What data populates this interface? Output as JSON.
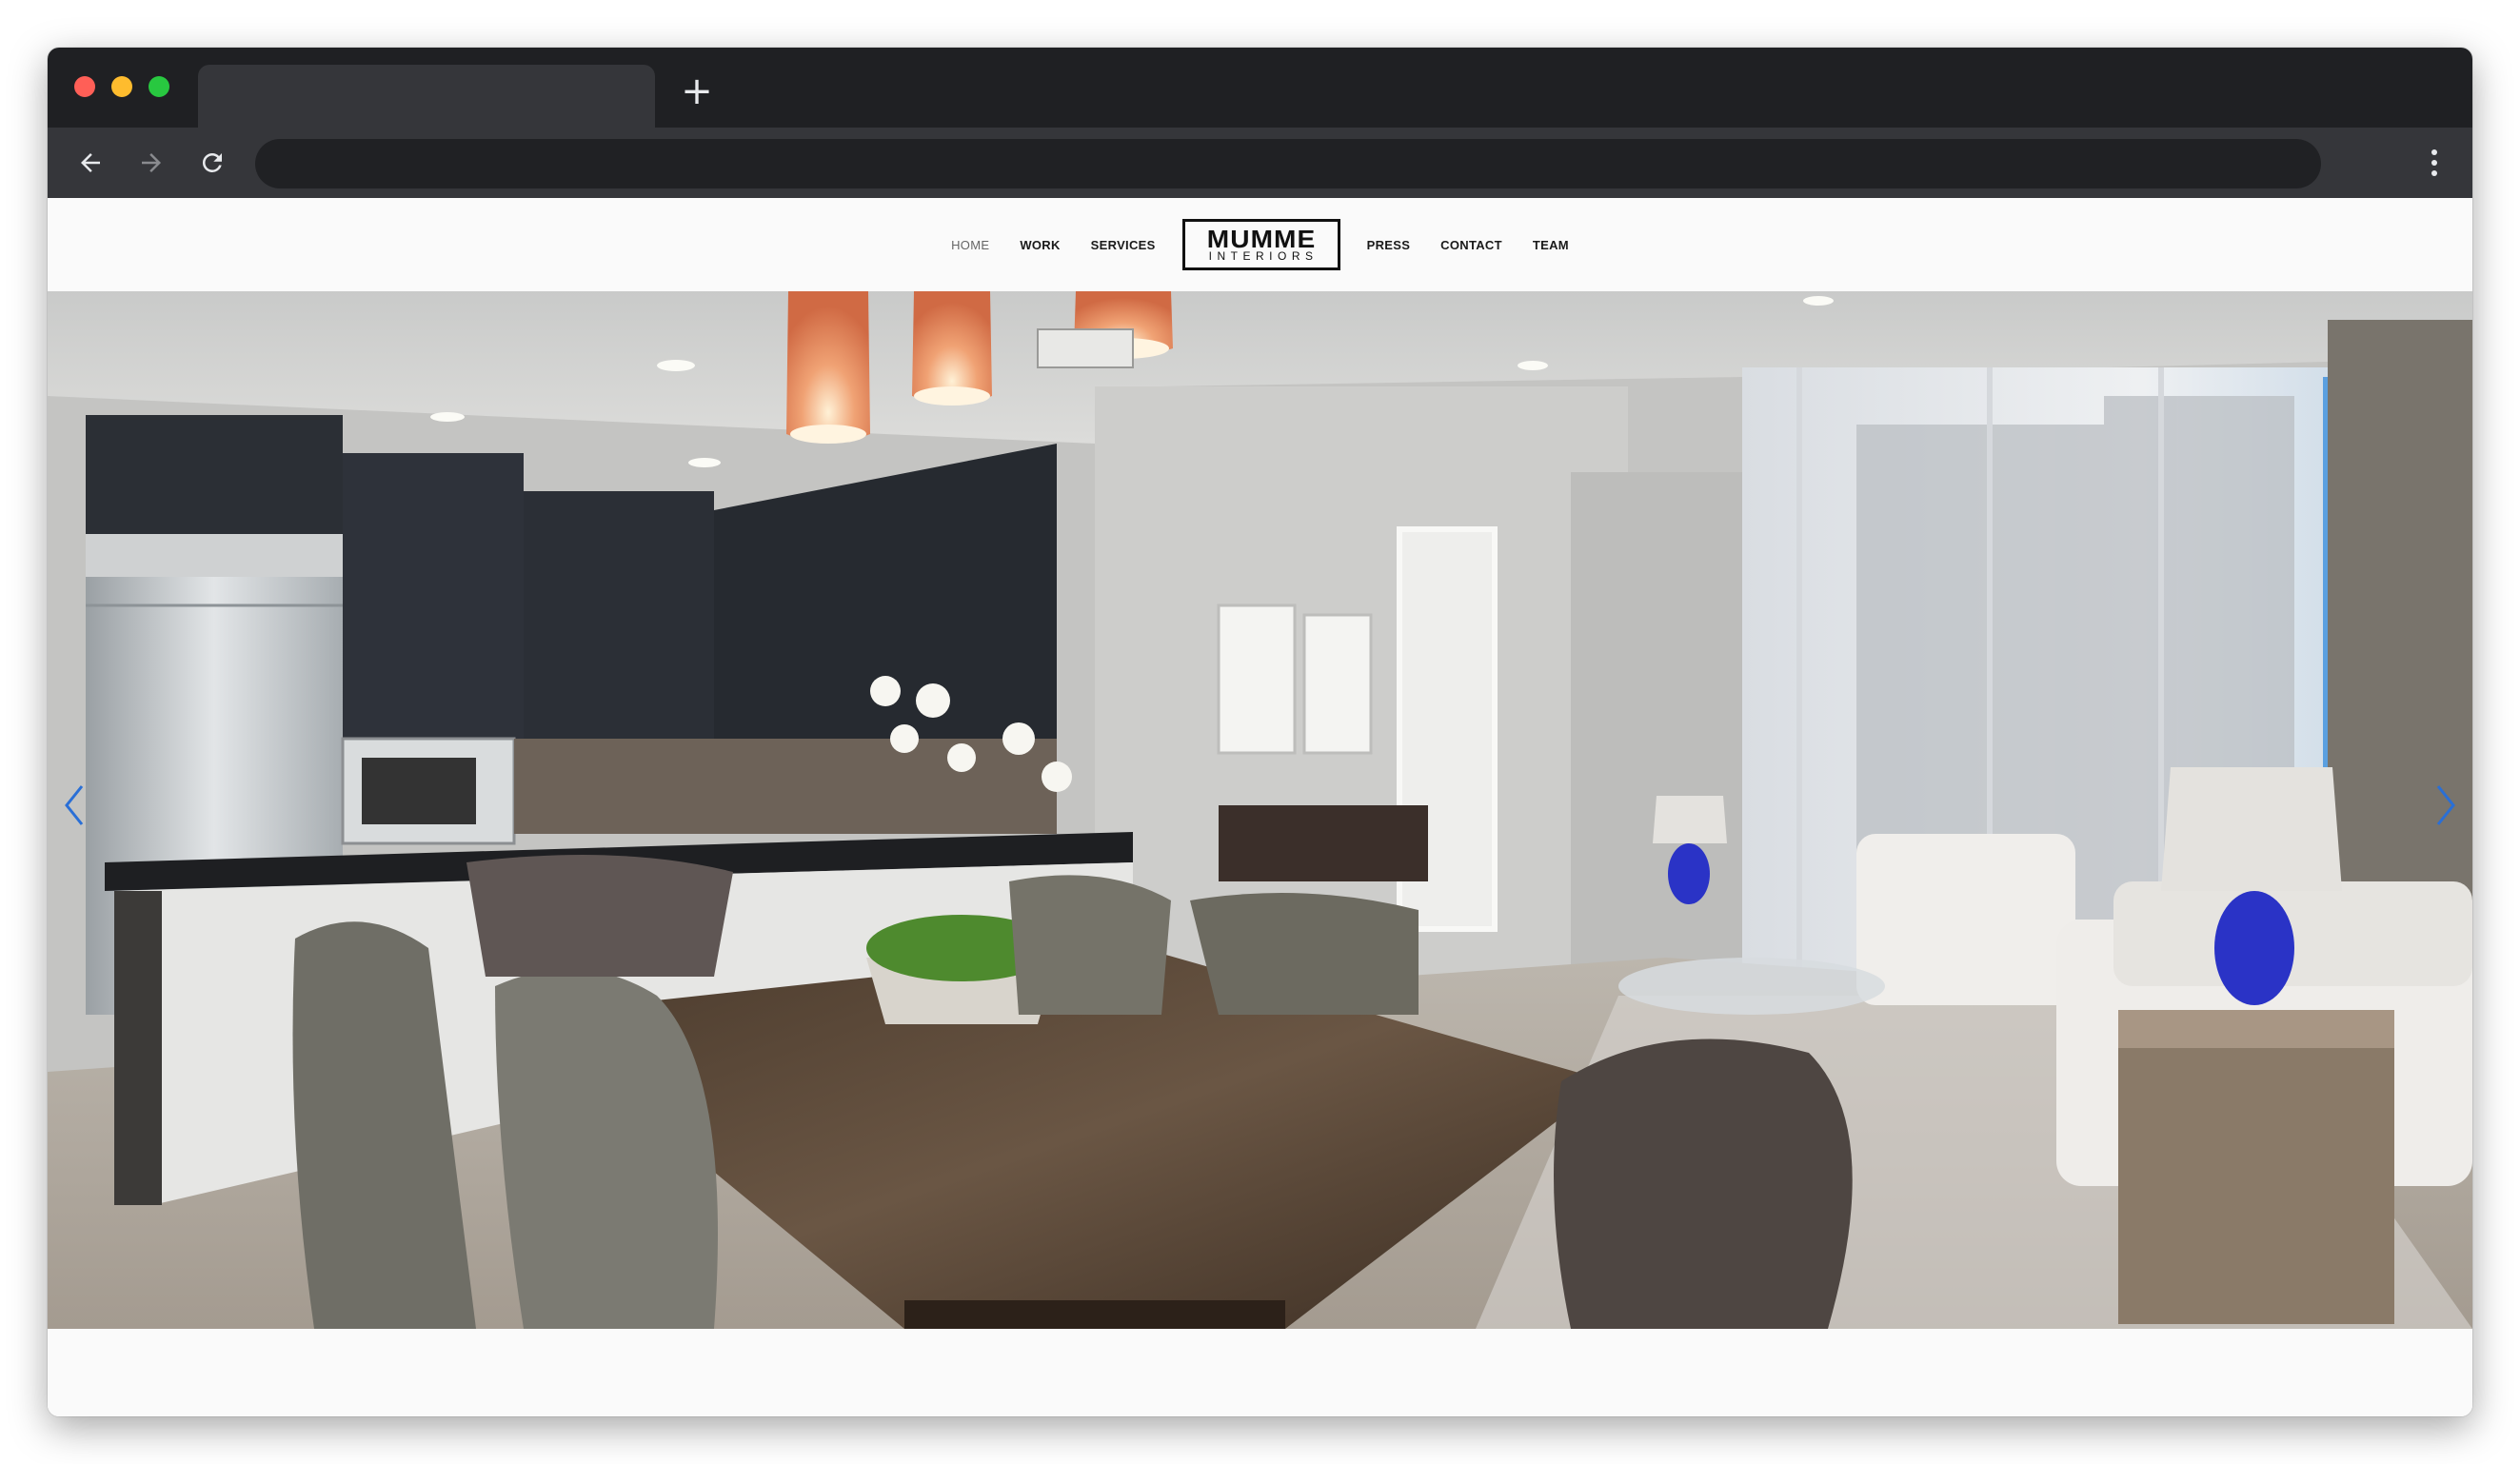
{
  "browser": {
    "tab_title": "",
    "address": "",
    "new_tab_symbol": "+",
    "icons": [
      "back-arrow-icon",
      "forward-arrow-icon",
      "reload-icon",
      "more-vert-icon"
    ]
  },
  "site": {
    "nav_left": [
      "HOME",
      "WORK",
      "SERVICES"
    ],
    "logo_main": "MUMME",
    "logo_sub": "INTERIORS",
    "nav_right": [
      "PRESS",
      "CONTACT",
      "TEAM"
    ],
    "active_item": "HOME"
  },
  "hero": {
    "slide_description_icon": "photo-dining-kitchen-living-room",
    "prev_icon": "chevron-left-icon",
    "next_icon": "chevron-right-icon",
    "arrow_color": "#2a6fd6"
  },
  "colors": {
    "chrome_dark": "#1f2023",
    "chrome_tab": "#35363a",
    "omnibox": "#202124",
    "page_bg": "#fafafa"
  }
}
